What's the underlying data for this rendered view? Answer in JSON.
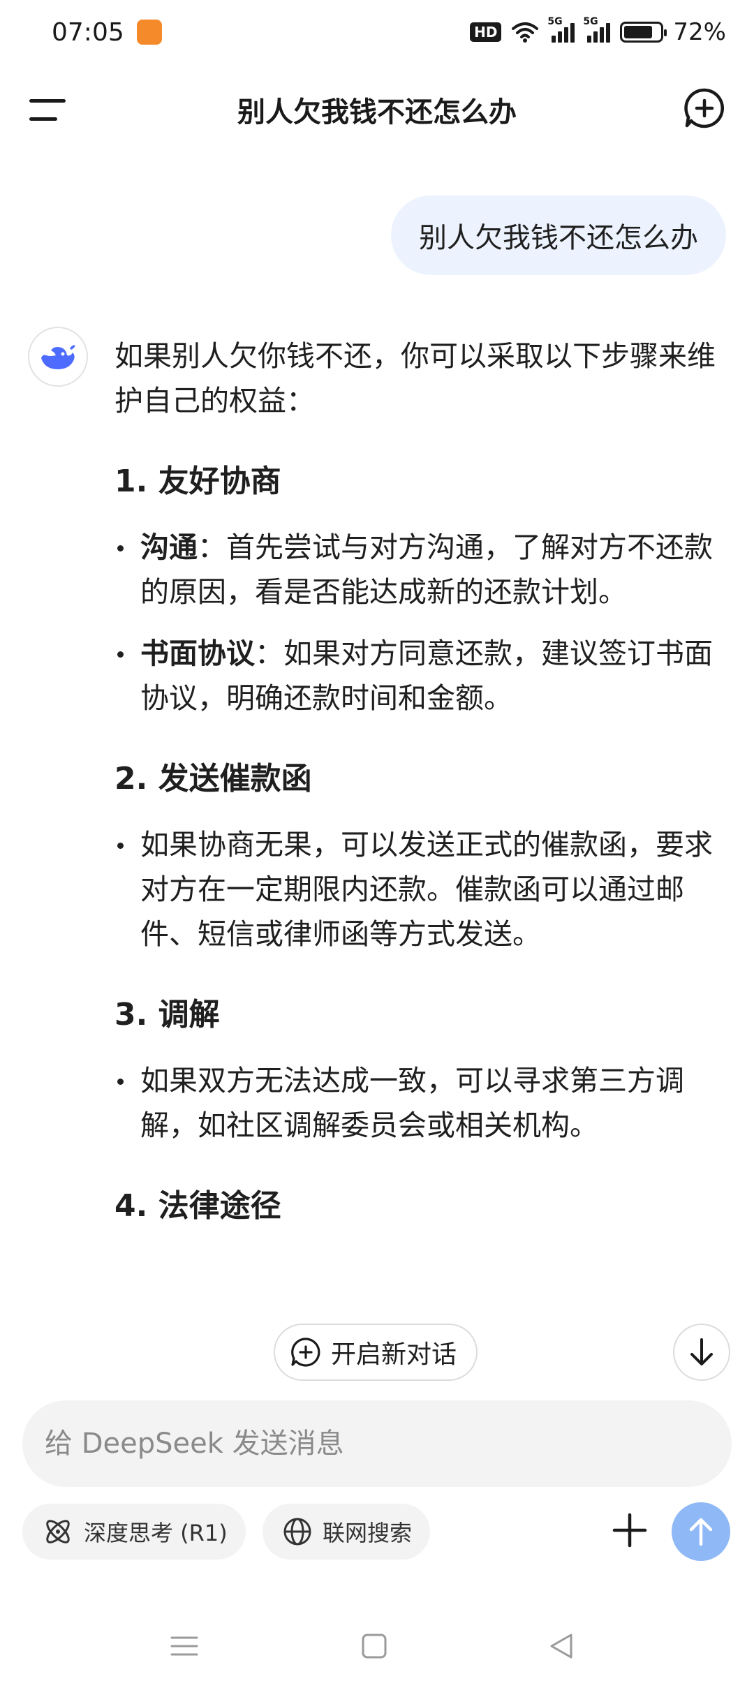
{
  "status_bar": {
    "time": "07:05",
    "network_badge": "HD",
    "signal1_tag": "5G",
    "signal2_tag": "5G",
    "battery": "72%"
  },
  "header": {
    "title": "别人欠我钱不还怎么办",
    "menu_icon": "menu-icon",
    "new_chat_icon": "new-chat-icon"
  },
  "user_message": "别人欠我钱不还怎么办",
  "assistant": {
    "intro": "如果别人欠你钱不还，你可以采取以下步骤来维护自己的权益：",
    "sections": [
      {
        "heading": "1. 友好协商",
        "bullets": [
          {
            "bold": "沟通",
            "text": "：首先尝试与对方沟通，了解对方不还款的原因，看是否能达成新的还款计划。"
          },
          {
            "bold": "书面协议",
            "text": "：如果对方同意还款，建议签订书面协议，明确还款时间和金额。"
          }
        ]
      },
      {
        "heading": "2. 发送催款函",
        "bullets": [
          {
            "text": "如果协商无果，可以发送正式的催款函，要求对方在一定期限内还款。催款函可以通过邮件、短信或律师函等方式发送。"
          }
        ]
      },
      {
        "heading": "3. 调解",
        "bullets": [
          {
            "text": "如果双方无法达成一致，可以寻求第三方调解，如社区调解委员会或相关机构。"
          }
        ]
      },
      {
        "heading": "4. 法律途径",
        "bullets": []
      }
    ]
  },
  "floating": {
    "new_dialog_label": "开启新对话"
  },
  "composer": {
    "placeholder": "给 DeepSeek 发送消息",
    "deep_think_label": "深度思考 (R1)",
    "web_search_label": "联网搜索"
  },
  "colors": {
    "user_bubble": "#edf3fe",
    "send_button": "#8fb8f6",
    "accent": "#4d6bfe"
  }
}
